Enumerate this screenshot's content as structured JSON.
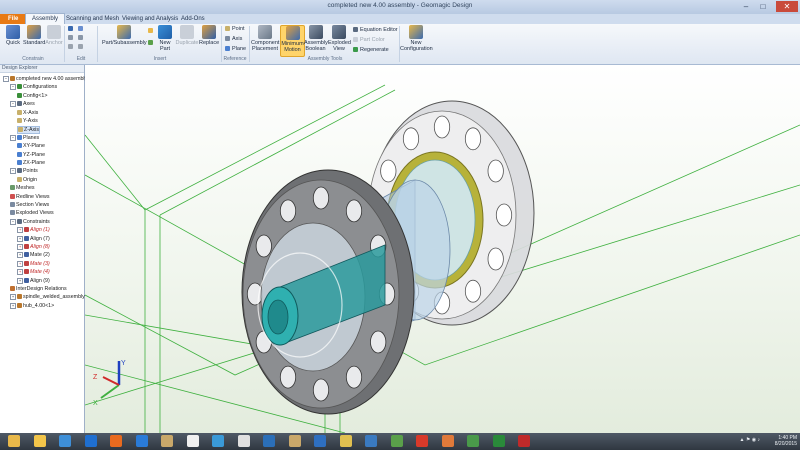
{
  "window": {
    "title": "completed new 4.00 assembly - Geomagic Design",
    "min": "–",
    "max": "□",
    "close": "✕"
  },
  "tabs": [
    "File",
    "Assembly",
    "Scanning and Mesh",
    "Viewing and Analysis",
    "Add-Ons"
  ],
  "active_tab": "Assembly",
  "ribbon": {
    "constrain": {
      "quick": "Quick",
      "standard": "Standard",
      "anchor": "Anchor",
      "group": "Constrain"
    },
    "edit": {
      "group": "Edit"
    },
    "insert": {
      "part_subassembly": "Part/Subassembly",
      "new_part": "New Part",
      "duplicate": "Duplicate",
      "replace": "Replace",
      "group": "Insert"
    },
    "reference": {
      "point": "Point",
      "axis": "Axis",
      "plane": "Plane",
      "group": "Reference"
    },
    "assembly_tools": {
      "component_placement": [
        "Component",
        "Placement"
      ],
      "minimum_motion": [
        "Minimum",
        "Motion"
      ],
      "assembly_boolean": [
        "Assembly",
        "Boolean"
      ],
      "exploded_view": [
        "Exploded",
        "View"
      ],
      "equation_editor": "Equation Editor",
      "part_color": "Part Color",
      "regenerate": "Regenerate",
      "group": "Assembly Tools"
    },
    "new_configuration": [
      "New",
      "Configuration"
    ]
  },
  "panel": {
    "header": "Design Explorer",
    "tree": [
      {
        "label": "completed new 4.00 assembly",
        "depth": 0,
        "exp": "−",
        "icon": "#b9772c"
      },
      {
        "label": "Configurations",
        "depth": 1,
        "exp": "−",
        "icon": "#3a8f3a"
      },
      {
        "label": "Config<1>",
        "depth": 2,
        "exp": "",
        "icon": "#3a8f3a"
      },
      {
        "label": "Axes",
        "depth": 1,
        "exp": "−",
        "icon": "#5a6a80"
      },
      {
        "label": "X-Axis",
        "depth": 2,
        "exp": "",
        "icon": "#c8b06a"
      },
      {
        "label": "Y-Axis",
        "depth": 2,
        "exp": "",
        "icon": "#c8b06a"
      },
      {
        "label": "Z-Axis",
        "depth": 2,
        "exp": "",
        "icon": "#c8b06a",
        "sel": true
      },
      {
        "label": "Planes",
        "depth": 1,
        "exp": "−",
        "icon": "#4a7fd0"
      },
      {
        "label": "XY-Plane",
        "depth": 2,
        "exp": "",
        "icon": "#4a7fd0"
      },
      {
        "label": "YZ-Plane",
        "depth": 2,
        "exp": "",
        "icon": "#4a7fd0"
      },
      {
        "label": "ZX-Plane",
        "depth": 2,
        "exp": "",
        "icon": "#4a7fd0"
      },
      {
        "label": "Points",
        "depth": 1,
        "exp": "−",
        "icon": "#5a6a80"
      },
      {
        "label": "Origin",
        "depth": 2,
        "exp": "",
        "icon": "#c8b06a"
      },
      {
        "label": "Meshes",
        "depth": 1,
        "exp": "",
        "icon": "#6a9a6a"
      },
      {
        "label": "Redline Views",
        "depth": 1,
        "exp": "",
        "icon": "#d05050"
      },
      {
        "label": "Section Views",
        "depth": 1,
        "exp": "",
        "icon": "#7a8aa0"
      },
      {
        "label": "Exploded Views",
        "depth": 1,
        "exp": "",
        "icon": "#7a8aa0"
      },
      {
        "label": "Constraints",
        "depth": 1,
        "exp": "−",
        "icon": "#5a6a80"
      },
      {
        "label": "Align (1)",
        "depth": 2,
        "exp": "+",
        "icon": "#c04040",
        "red": true
      },
      {
        "label": "Align (7)",
        "depth": 2,
        "exp": "+",
        "icon": "#4060a0"
      },
      {
        "label": "Align (8)",
        "depth": 2,
        "exp": "+",
        "icon": "#c04040",
        "red": true
      },
      {
        "label": "Mate (2)",
        "depth": 2,
        "exp": "+",
        "icon": "#4060a0"
      },
      {
        "label": "Mate (3)",
        "depth": 2,
        "exp": "+",
        "icon": "#c04040",
        "red": true
      },
      {
        "label": "Mate (4)",
        "depth": 2,
        "exp": "+",
        "icon": "#c04040",
        "red": true
      },
      {
        "label": "Align (9)",
        "depth": 2,
        "exp": "+",
        "icon": "#4060a0"
      },
      {
        "label": "InterDesign Relations",
        "depth": 1,
        "exp": "",
        "icon": "#c07030"
      },
      {
        "label": "spindle_welded_assembly",
        "depth": 1,
        "exp": "+",
        "icon": "#b9772c"
      },
      {
        "label": "hub_4.00<1>",
        "depth": 1,
        "exp": "+",
        "icon": "#b9772c"
      }
    ]
  },
  "triad": {
    "x": "X",
    "y": "Y",
    "z": "Z"
  },
  "taskbar": {
    "icons": [
      "#e8b84a",
      "#f3c54a",
      "#3e8fd8",
      "#1f6fd0",
      "#e86a1f",
      "#2a7bd8",
      "#c9a86a",
      "#f0f0f0",
      "#3a9ad8",
      "#e0e0e0",
      "#2b6fb8",
      "#c9a86a",
      "#2e6fc0",
      "#e0c050",
      "#3a7ac0",
      "#5aa04a",
      "#d83a2a",
      "#e07a3a",
      "#4a9a4a",
      "#2a8a3a",
      "#c02a2a"
    ],
    "clock_line1": "1:40 PM",
    "clock_line2": "8/20/2015"
  },
  "colors": {
    "grid": "#3fb03f",
    "model_gray": "#7d7f82",
    "hub_teal": "#1f9aa0",
    "ring_olive": "#b7b23a"
  }
}
